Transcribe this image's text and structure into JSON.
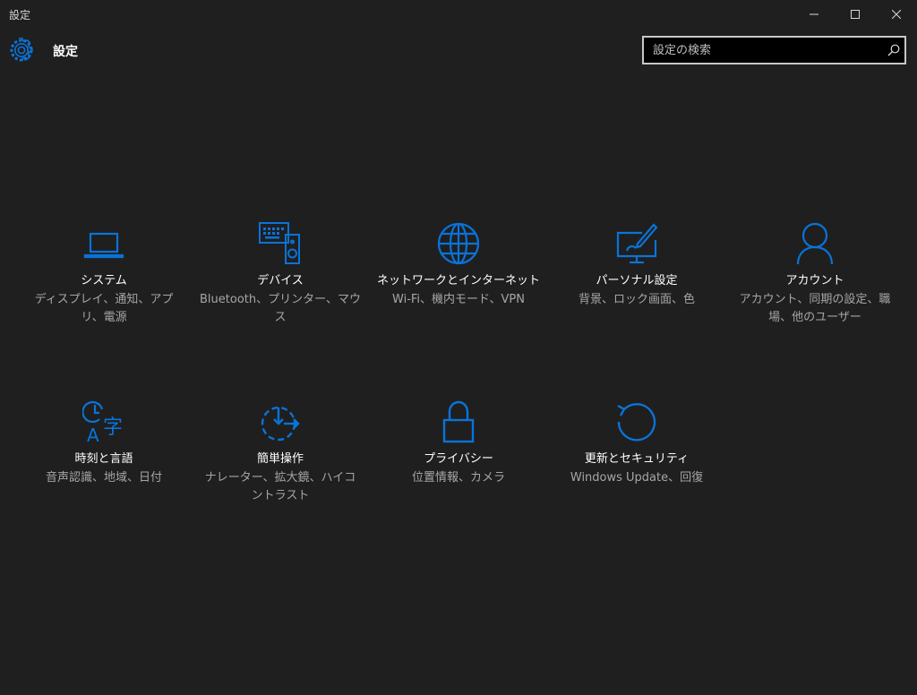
{
  "window": {
    "title": "設定"
  },
  "header": {
    "title": "設定"
  },
  "search": {
    "placeholder": "設定の検索"
  },
  "colors": {
    "accent": "#0a73d9",
    "background": "#1f1f1f",
    "description_text": "#a6a6a6"
  },
  "tiles": [
    {
      "label": "システム",
      "desc": "ディスプレイ、通知、アプリ、電源",
      "icon": "laptop-icon"
    },
    {
      "label": "デバイス",
      "desc": "Bluetooth、プリンター、マウス",
      "icon": "devices-icon"
    },
    {
      "label": "ネットワークとインターネット",
      "desc": "Wi-Fi、機内モード、VPN",
      "icon": "globe-icon"
    },
    {
      "label": "パーソナル設定",
      "desc": "背景、ロック画面、色",
      "icon": "personalization-icon"
    },
    {
      "label": "アカウント",
      "desc": "アカウント、同期の設定、職場、他のユーザー",
      "icon": "account-icon"
    },
    {
      "label": "時刻と言語",
      "desc": "音声認識、地域、日付",
      "icon": "time-language-icon"
    },
    {
      "label": "簡単操作",
      "desc": "ナレーター、拡大鏡、ハイコントラスト",
      "icon": "ease-of-access-icon"
    },
    {
      "label": "プライバシー",
      "desc": "位置情報、カメラ",
      "icon": "lock-icon"
    },
    {
      "label": "更新とセキュリティ",
      "desc": "Windows Update、回復",
      "icon": "update-icon"
    }
  ]
}
